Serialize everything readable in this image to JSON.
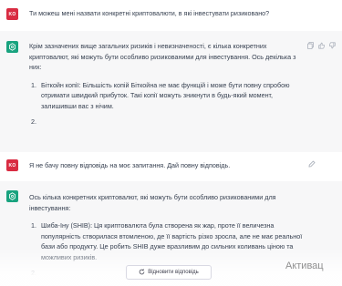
{
  "conversation": [
    {
      "role": "user",
      "avatar": "KO",
      "text": "Ти можеш мені назвати конкретні криптовалюти, в які інвестувати ризиковано?"
    },
    {
      "role": "assistant",
      "intro": "Крім зазначених вище загальних ризиків і невизначеності, є кілька конкретних криптовалют, які можуть бути особливо ризикованими для інвестування. Ось декілька з них:",
      "items": [
        "Біткойн копії: Більшість копій Біткойна не має функцій і може бути повну спробою отримати швидкий прибуток. Такі копії можуть зникнути в будь-який момент, залишивши вас з нічим.",
        ""
      ]
    },
    {
      "role": "user",
      "avatar": "KO",
      "text": "Я не бачу повну відповідь на моє запитання. Дай повну відповідь."
    },
    {
      "role": "assistant",
      "intro": "Ось кілька конкретних криптовалют, які можуть бути особливо ризикованими для інвестування:",
      "items": [
        "Шиба-Іну (SHIB): Ця криптовалюта була створена як жар, проте її величезна популярність створилася втомленою, де її вартість різко зросла, але не має реальної бази або продукту. Це робить SHIB дуже вразливим до сильних коливань ціною та можливих ризиків.",
        ""
      ]
    }
  ],
  "regenerate_button": "Відновити відповідь",
  "watermark": "Активац",
  "colors": {
    "user_avatar": "#d92c42",
    "bot_avatar": "#19a37f",
    "bot_bg": "#f7f7f8"
  }
}
